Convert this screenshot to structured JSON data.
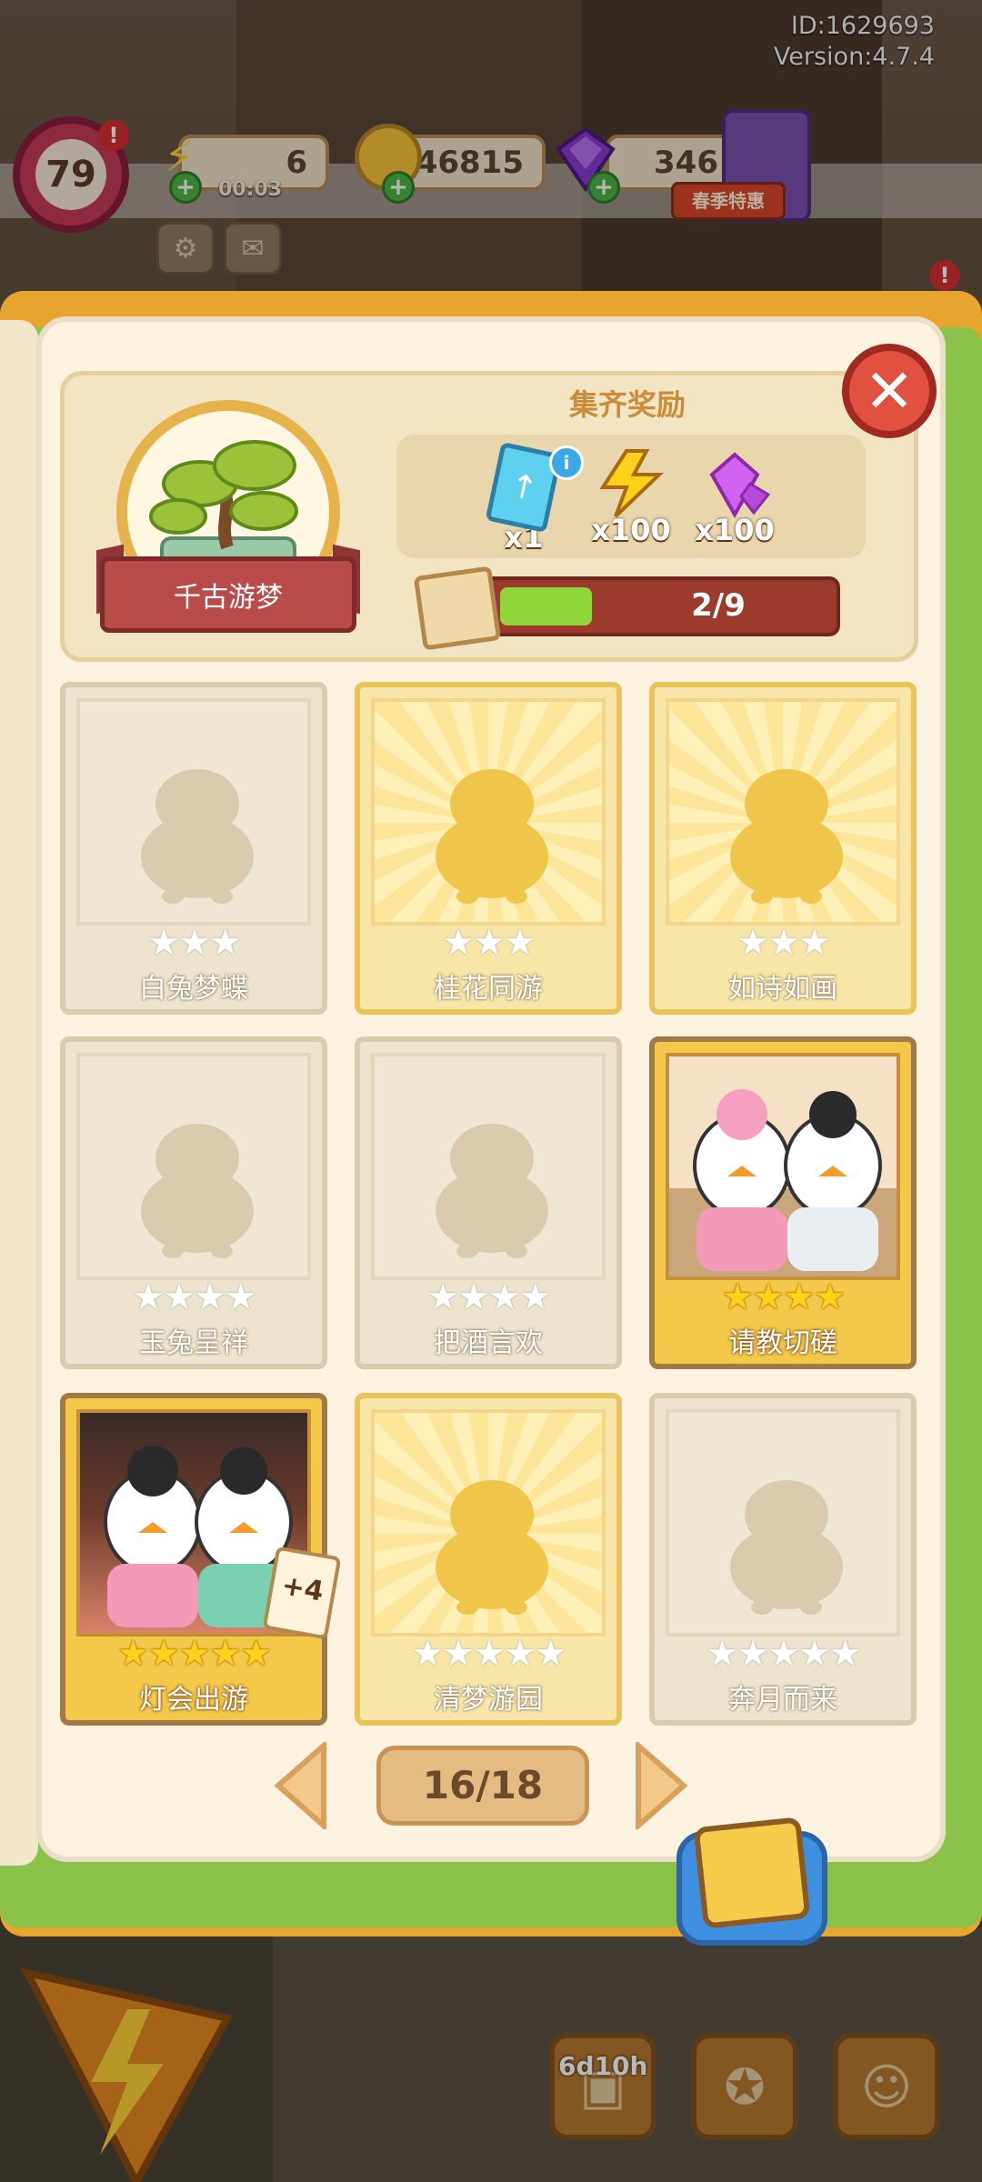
{
  "header": {
    "id_label": "ID:1629693",
    "version_label": "Version:4.7.4"
  },
  "hud": {
    "level": "79",
    "energy": "6",
    "energy_timer": "00:03",
    "coins": "146815",
    "gems": "346",
    "promo_label": "春季特惠"
  },
  "collection": {
    "reward_title": "集齐奖励",
    "album_name": "千古游梦",
    "rewards": [
      {
        "icon": "upgrade-card-icon",
        "count": "x1"
      },
      {
        "icon": "energy-bolt-icon",
        "count": "x100"
      },
      {
        "icon": "purple-gem-icon",
        "count": "x100"
      }
    ],
    "progress_text": "2/9",
    "progress_fraction": 0.22,
    "cards": [
      {
        "name": "白兔梦蝶",
        "stars": "★★★",
        "state": "locked"
      },
      {
        "name": "桂花同游",
        "stars": "★★★",
        "state": "gold"
      },
      {
        "name": "如诗如画",
        "stars": "★★★",
        "state": "gold"
      },
      {
        "name": "玉兔呈祥",
        "stars": "★★★★",
        "state": "locked"
      },
      {
        "name": "把酒言欢",
        "stars": "★★★★",
        "state": "locked"
      },
      {
        "name": "请教切磋",
        "stars": "★★★★",
        "state": "owned"
      },
      {
        "name": "灯会出游",
        "stars": "★★★★★",
        "state": "owned",
        "extra": "+4"
      },
      {
        "name": "清梦游园",
        "stars": "★★★★★",
        "state": "gold"
      },
      {
        "name": "奔月而来",
        "stars": "★★★★★",
        "state": "locked"
      }
    ],
    "page_indicator": "16/18"
  },
  "bottom": {
    "event_countdown": "6d10h"
  },
  "colors": {
    "book_orange": "#e7a530",
    "book_green": "#8bc34a",
    "page_cream": "#fbf3e0",
    "close_red": "#e2503f",
    "progress_fill": "#8fd63a"
  }
}
